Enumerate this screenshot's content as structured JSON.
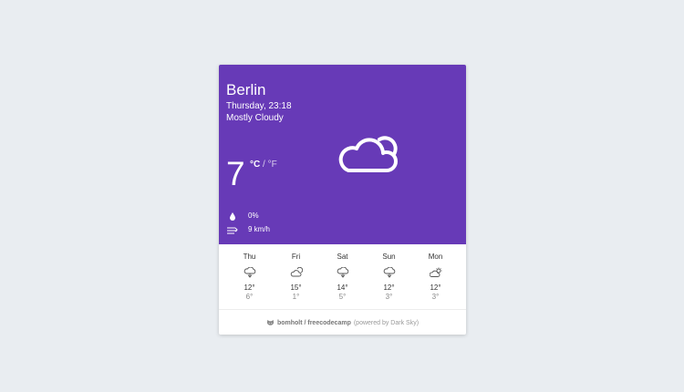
{
  "weather": {
    "city": "Berlin",
    "datetime": "Thursday, 23:18",
    "condition": "Mostly Cloudy",
    "temperature": "7",
    "unit_c": "°C",
    "unit_sep": "/",
    "unit_f": "°F",
    "precipitation": "0%",
    "wind": "9 km/h",
    "main_icon": "cloud-moon-icon"
  },
  "forecast": [
    {
      "day": "Thu",
      "high": "12°",
      "low": "6°",
      "icon": "cloud-rain-icon"
    },
    {
      "day": "Fri",
      "high": "15°",
      "low": "1°",
      "icon": "cloud-moon-icon"
    },
    {
      "day": "Sat",
      "high": "14°",
      "low": "5°",
      "icon": "cloud-rain-icon"
    },
    {
      "day": "Sun",
      "high": "12°",
      "low": "3°",
      "icon": "cloud-rain-icon"
    },
    {
      "day": "Mon",
      "high": "12°",
      "low": "3°",
      "icon": "cloud-sun-icon"
    }
  ],
  "footer": {
    "repo": "bomholt / freecodecamp",
    "powered": "(powered by Dark Sky)",
    "icon": "github-icon"
  },
  "colors": {
    "accent": "#673ab7",
    "background": "#e9edf1",
    "card": "#ffffff"
  }
}
